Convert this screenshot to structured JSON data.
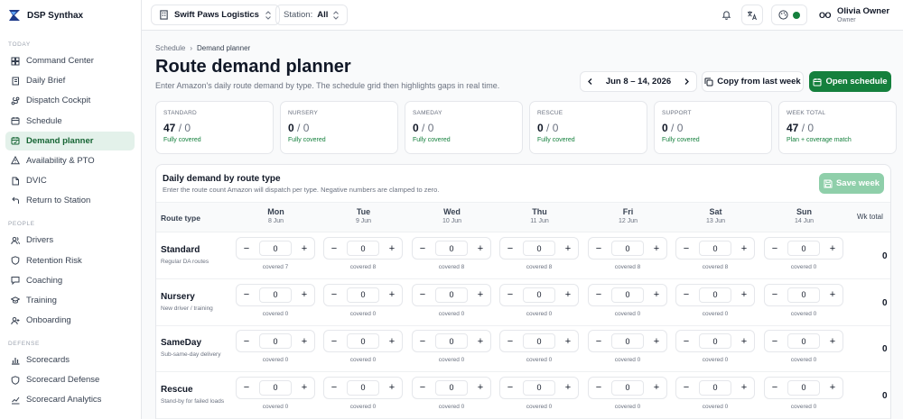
{
  "app": {
    "name": "DSP Synthax"
  },
  "sidebar": {
    "sections": [
      {
        "label": "TODAY",
        "items": [
          {
            "label": "Command Center",
            "icon": "dashboard-icon"
          },
          {
            "label": "Daily Brief",
            "icon": "notebook-icon"
          },
          {
            "label": "Dispatch Cockpit",
            "icon": "route-icon"
          },
          {
            "label": "Schedule",
            "icon": "calendar-icon"
          },
          {
            "label": "Demand planner",
            "icon": "calendar-check-icon",
            "active": true
          },
          {
            "label": "Availability & PTO",
            "icon": "warning-icon"
          },
          {
            "label": "DVIC",
            "icon": "file-icon"
          },
          {
            "label": "Return to Station",
            "icon": "return-icon"
          }
        ]
      },
      {
        "label": "PEOPLE",
        "items": [
          {
            "label": "Drivers",
            "icon": "users-icon"
          },
          {
            "label": "Retention Risk",
            "icon": "shield-icon"
          },
          {
            "label": "Coaching",
            "icon": "message-icon"
          },
          {
            "label": "Training",
            "icon": "graduation-icon"
          },
          {
            "label": "Onboarding",
            "icon": "user-plus-icon"
          }
        ]
      },
      {
        "label": "DEFENSE",
        "items": [
          {
            "label": "Scorecards",
            "icon": "bar-chart-icon"
          },
          {
            "label": "Scorecard Defense",
            "icon": "shield-icon"
          },
          {
            "label": "Scorecard Analytics",
            "icon": "analytics-icon"
          }
        ]
      }
    ]
  },
  "topbar": {
    "org": "Swift Paws Logistics",
    "station_label": "Station:",
    "station_value": "All",
    "user_name": "Olivia Owner",
    "user_role": "Owner",
    "user_avatar": "OO",
    "status_color": "#15803d"
  },
  "page": {
    "breadcrumb": [
      "Schedule",
      "Demand planner"
    ],
    "title": "Route demand planner",
    "subtitle": "Enter Amazon's daily route demand by type. The schedule grid then highlights gaps in real time.",
    "week_range": "Jun 8 – 14, 2026",
    "copy_label": "Copy from last week",
    "open_label": "Open schedule"
  },
  "stats": [
    {
      "label": "STANDARD",
      "value": "47",
      "rest": " / 0",
      "note": "Fully covered"
    },
    {
      "label": "NURSERY",
      "value": "0",
      "rest": " / 0",
      "note": "Fully covered"
    },
    {
      "label": "SAMEDAY",
      "value": "0",
      "rest": " / 0",
      "note": "Fully covered"
    },
    {
      "label": "RESCUE",
      "value": "0",
      "rest": " / 0",
      "note": "Fully covered"
    },
    {
      "label": "SUPPORT",
      "value": "0",
      "rest": " / 0",
      "note": "Fully covered"
    },
    {
      "label": "WEEK TOTAL",
      "value": "47",
      "rest": " / 0",
      "note": "Plan + coverage match"
    }
  ],
  "demand": {
    "title": "Daily demand by route type",
    "subtitle": "Enter the route count Amazon will dispatch per type. Negative numbers are clamped to zero.",
    "save_label": "Save week",
    "route_type_header": "Route type",
    "wk_total_header": "Wk total",
    "days": [
      {
        "name": "Mon",
        "date": "8 Jun"
      },
      {
        "name": "Tue",
        "date": "9 Jun"
      },
      {
        "name": "Wed",
        "date": "10 Jun"
      },
      {
        "name": "Thu",
        "date": "11 Jun"
      },
      {
        "name": "Fri",
        "date": "12 Jun"
      },
      {
        "name": "Sat",
        "date": "13 Jun"
      },
      {
        "name": "Sun",
        "date": "14 Jun"
      }
    ],
    "rows": [
      {
        "name": "Standard",
        "desc": "Regular DA routes",
        "values": [
          "0",
          "0",
          "0",
          "0",
          "0",
          "0",
          "0"
        ],
        "covered": [
          "covered 7",
          "covered 8",
          "covered 8",
          "covered 8",
          "covered 8",
          "covered 8",
          "covered 0"
        ],
        "total": "0"
      },
      {
        "name": "Nursery",
        "desc": "New driver / training",
        "values": [
          "0",
          "0",
          "0",
          "0",
          "0",
          "0",
          "0"
        ],
        "covered": [
          "covered 0",
          "covered 0",
          "covered 0",
          "covered 0",
          "covered 0",
          "covered 0",
          "covered 0"
        ],
        "total": "0"
      },
      {
        "name": "SameDay",
        "desc": "Sub-same-day delivery",
        "values": [
          "0",
          "0",
          "0",
          "0",
          "0",
          "0",
          "0"
        ],
        "covered": [
          "covered 0",
          "covered 0",
          "covered 0",
          "covered 0",
          "covered 0",
          "covered 0",
          "covered 0"
        ],
        "total": "0"
      },
      {
        "name": "Rescue",
        "desc": "Stand-by for failed loads",
        "values": [
          "0",
          "0",
          "0",
          "0",
          "0",
          "0",
          "0"
        ],
        "covered": [
          "covered 0",
          "covered 0",
          "covered 0",
          "covered 0",
          "covered 0",
          "covered 0",
          "covered 0"
        ],
        "total": "0"
      }
    ]
  },
  "colors": {
    "accent": "#15803d",
    "active_bg": "#e3f1ea",
    "save_disabled": "#8fcfaa"
  }
}
